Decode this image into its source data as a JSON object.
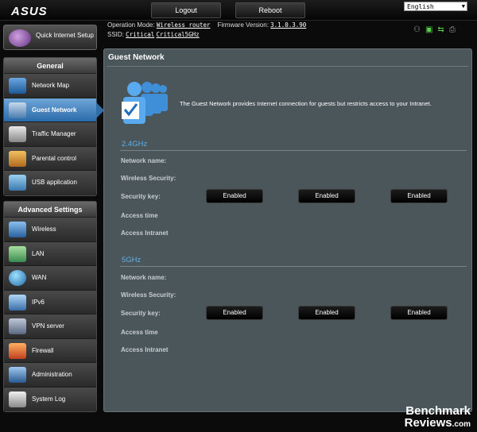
{
  "header": {
    "logo": "ASUS",
    "logout_label": "Logout",
    "reboot_label": "Reboot",
    "language": "English"
  },
  "info": {
    "op_mode_label": "Operation Mode:",
    "op_mode_value": "Wireless router",
    "firmware_label": "Firmware Version:",
    "firmware_value": "3.1.0.3.90",
    "ssid_label": "SSID:",
    "ssid_1": "Critical",
    "ssid_2": "Critical5GHz"
  },
  "sidebar": {
    "quick_setup": "Quick Internet Setup",
    "general_heading": "General",
    "general_items": [
      {
        "label": "Network Map"
      },
      {
        "label": "Guest Network"
      },
      {
        "label": "Traffic Manager"
      },
      {
        "label": "Parental control"
      },
      {
        "label": "USB application"
      }
    ],
    "advanced_heading": "Advanced Settings",
    "advanced_items": [
      {
        "label": "Wireless"
      },
      {
        "label": "LAN"
      },
      {
        "label": "WAN"
      },
      {
        "label": "IPv6"
      },
      {
        "label": "VPN server"
      },
      {
        "label": "Firewall"
      },
      {
        "label": "Administration"
      },
      {
        "label": "System Log"
      }
    ]
  },
  "main": {
    "title": "Guest Network",
    "description": "The Guest Network provides Internet connection for guests but restricts access to your Intranet.",
    "bands": [
      {
        "name": "2.4GHz",
        "rows": [
          "Network name:",
          "Wireless Security:",
          "Security key:",
          "Access time",
          "Access Intranet"
        ],
        "buttons": [
          "Enabled",
          "Enabled",
          "Enabled"
        ]
      },
      {
        "name": "5GHz",
        "rows": [
          "Network name:",
          "Wireless Security:",
          "Security key:",
          "Access time",
          "Access Intranet"
        ],
        "buttons": [
          "Enabled",
          "Enabled",
          "Enabled"
        ]
      }
    ]
  },
  "watermark": {
    "line1": "Benchmark",
    "line2": "Reviews",
    "line2_suffix": ".com"
  }
}
